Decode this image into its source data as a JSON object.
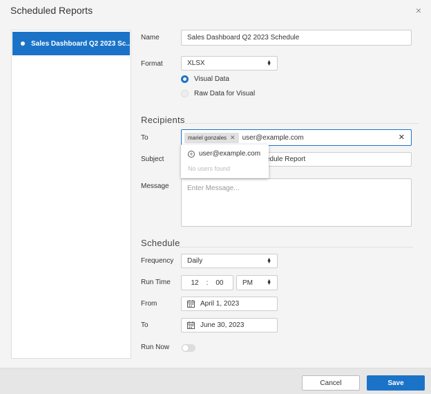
{
  "dialog": {
    "title": "Scheduled Reports",
    "close_glyph": "×"
  },
  "reports": {
    "items": [
      {
        "label": "Sales Dashboard Q2 2023 Sc..."
      }
    ]
  },
  "form": {
    "name_label": "Name",
    "name_value": "Sales Dashboard Q2 2023 Schedule",
    "format_label": "Format",
    "format_value": "XLSX",
    "format_options": [
      "Visual Data",
      "Raw Data for Visual"
    ],
    "format_selected": "Visual Data"
  },
  "recipients": {
    "heading": "Recipients",
    "to_label": "To",
    "chip": "mariel gonzales",
    "to_input": "user@example.com",
    "clear_glyph": "✕",
    "subject_label": "Subject",
    "subject_value": "edule Report",
    "message_label": "Message",
    "message_placeholder": "Enter Message...",
    "suggestion": "user@example.com",
    "no_users": "No users found"
  },
  "schedule": {
    "heading": "Schedule",
    "frequency_label": "Frequency",
    "frequency_value": "Daily",
    "run_time_label": "Run Time",
    "hour": "12",
    "colon": ":",
    "minute": "00",
    "ampm": "PM",
    "from_label": "From",
    "from_value": "April 1, 2023",
    "to_label": "To",
    "to_value": "June 30, 2023",
    "run_now_label": "Run Now",
    "run_now_on": false
  },
  "footer": {
    "cancel": "Cancel",
    "save": "Save"
  },
  "colors": {
    "accent": "#1b73c8",
    "background": "#f4f4f4"
  }
}
